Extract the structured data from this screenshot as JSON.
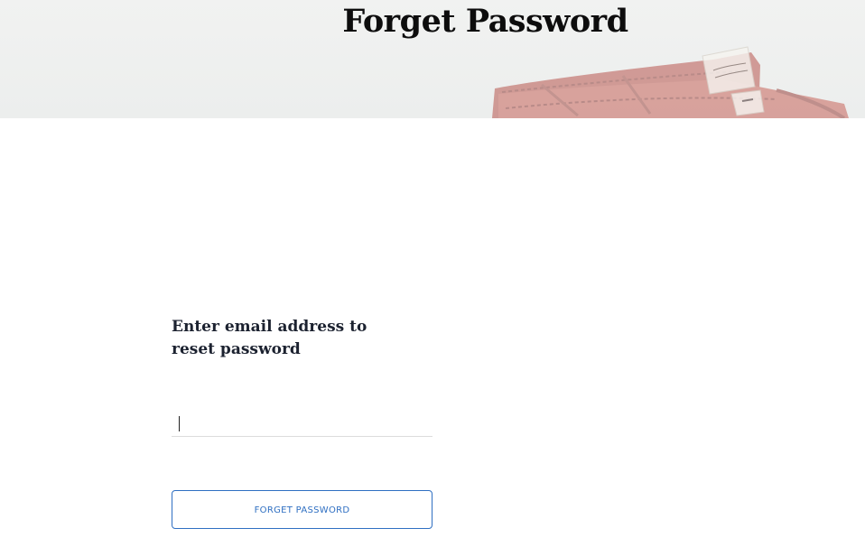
{
  "hero": {
    "title": "Forget Password"
  },
  "form": {
    "heading": "Enter email address to reset password",
    "email": {
      "value": "",
      "placeholder": ""
    },
    "submit_label": "FORGET PASSWORD"
  },
  "colors": {
    "accent": "#2f6fc2",
    "heading_text": "#1c2230",
    "banner_bg": "#eeefee"
  }
}
